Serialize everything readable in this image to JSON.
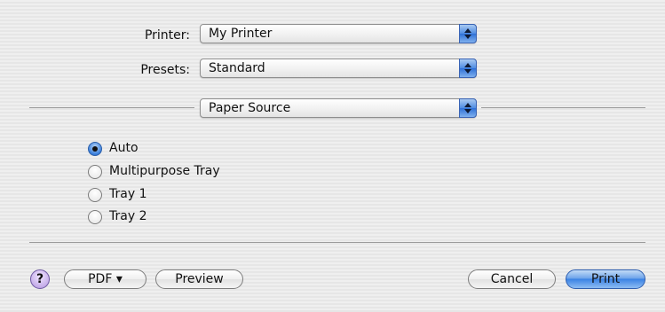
{
  "printer": {
    "label": "Printer:",
    "value": "My Printer"
  },
  "presets": {
    "label": "Presets:",
    "value": "Standard"
  },
  "panel": {
    "value": "Paper Source"
  },
  "paper_source": {
    "options": [
      {
        "label": "Auto",
        "selected": true
      },
      {
        "label": "Multipurpose Tray",
        "selected": false
      },
      {
        "label": "Tray 1",
        "selected": false
      },
      {
        "label": "Tray 2",
        "selected": false
      }
    ]
  },
  "buttons": {
    "help": "?",
    "pdf": "PDF ▾",
    "preview": "Preview",
    "cancel": "Cancel",
    "print": "Print"
  },
  "colors": {
    "accent": "#3a82e4",
    "help": "#c6aee9"
  }
}
